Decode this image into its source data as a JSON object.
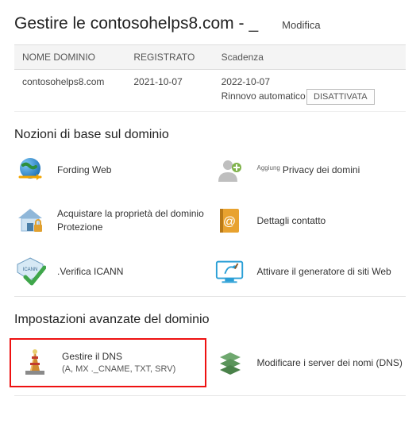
{
  "header": {
    "title": "Gestire le contosohelps8.com -",
    "edit_label": "Modifica"
  },
  "domain_table": {
    "col_name": "NOME DOMINIO",
    "col_registered": "REGISTRATO",
    "col_expiry": "Scadenza",
    "row": {
      "name": "contosohelps8.com",
      "registered": "2021-10-07",
      "expiry": "2022-10-07",
      "renew_label": "Rinnovo automatico",
      "renew_status": "DISATTIVATA"
    }
  },
  "sections": {
    "basics_title": "Nozioni di base sul dominio",
    "advanced_title": "Impostazioni avanzate del dominio"
  },
  "basics": {
    "forwarding": "Fording Web",
    "privacy_prefix": "Aggiung",
    "privacy": "Privacy dei domini",
    "ownership_line1": "Acquistare la proprietà del dominio",
    "ownership_line2": "Protezione",
    "contact": "Dettagli contatto",
    "icann_prefix": ".",
    "icann": "Verifica ICANN",
    "sitebuilder": "Attivare il generatore di siti Web"
  },
  "advanced": {
    "dns_line1": "Gestire il DNS",
    "dns_line2": "(A, MX ._CNAME, TXT, SRV)",
    "nameservers": "Modificare i server dei nomi (DNS)"
  }
}
